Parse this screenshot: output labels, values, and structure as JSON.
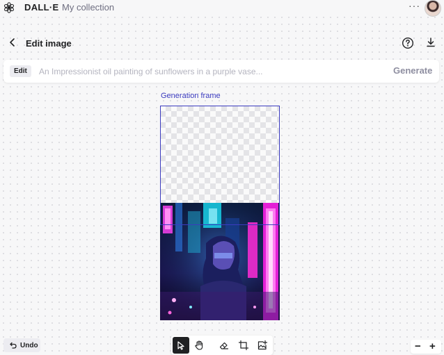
{
  "app": {
    "brand": "DALL·E",
    "collection_link": "My collection",
    "more_label": "···"
  },
  "header": {
    "title": "Edit image"
  },
  "prompt": {
    "badge": "Edit",
    "placeholder": "An Impressionist oil painting of sunflowers in a purple vase...",
    "value": "",
    "generate_label": "Generate"
  },
  "canvas": {
    "frame_label": "Generation frame"
  },
  "footer": {
    "undo_label": "Undo",
    "zoom_out": "−",
    "zoom_in": "+"
  },
  "toolbar": {
    "tools": [
      {
        "icon": "select-arrow-icon",
        "active": true
      },
      {
        "icon": "hand-pan-icon",
        "active": false
      },
      {
        "icon": "eraser-icon",
        "active": false
      },
      {
        "icon": "add-frame-icon",
        "active": false
      },
      {
        "icon": "upload-image-icon",
        "active": false
      }
    ]
  },
  "colors": {
    "accent": "#3b3bbf",
    "background": "#f7f7f8",
    "active_tool": "#202123"
  }
}
